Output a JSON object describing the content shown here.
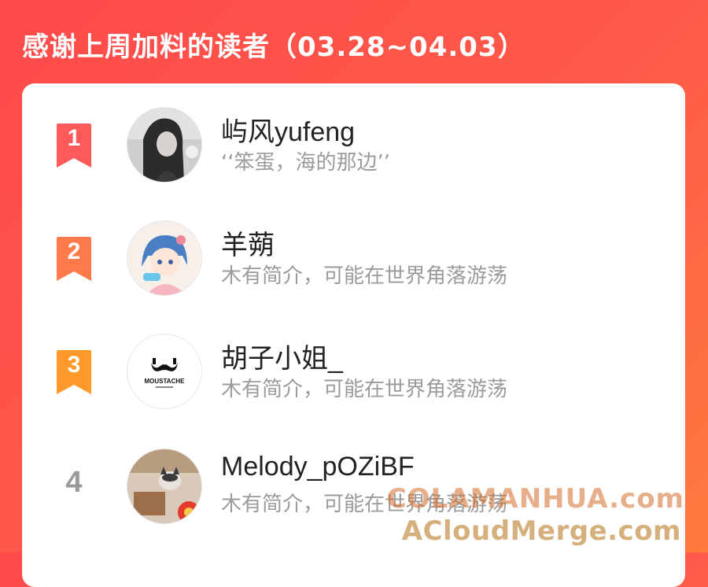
{
  "title": "感谢上周加料的读者（03.28~04.03）",
  "readers": [
    {
      "rank": "1",
      "name": "屿风yufeng",
      "bio": "‘‘笨蛋，海的那边’’",
      "badge_color": "#ff5a5a",
      "avatar": "girl-portrait-avatar"
    },
    {
      "rank": "2",
      "name": "羊蒴",
      "bio": "木有简介，可能在世界角落游荡",
      "badge_color": "#ff7a4a",
      "avatar": "anime-girl-avatar"
    },
    {
      "rank": "3",
      "name": "胡子小姐_",
      "bio": "木有简介，可能在世界角落游荡",
      "badge_color": "#ff9a2a",
      "avatar": "moustache-logo-avatar",
      "avatar_text": "MOUSTACHE"
    },
    {
      "rank": "4",
      "name": "Melody_pOZiBF",
      "bio": "木有简介，可能在世界角落游荡",
      "avatar": "cat-photo-avatar"
    }
  ],
  "watermark": {
    "line1": "COLAMANHUA.com",
    "line2": "ACloudMerge.com"
  }
}
